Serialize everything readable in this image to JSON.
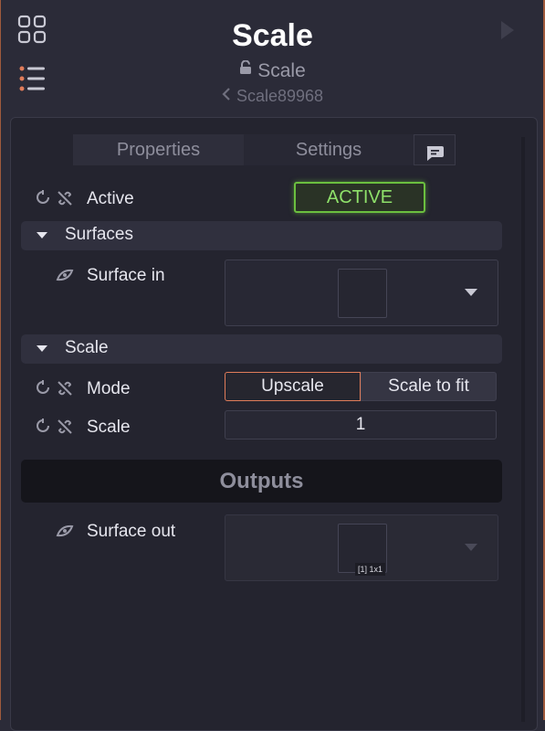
{
  "header": {
    "title": "Scale",
    "subtitle": "Scale",
    "breadcrumb": "Scale89968"
  },
  "tabs": {
    "properties": "Properties",
    "settings": "Settings"
  },
  "rows": {
    "active_label": "Active",
    "active_value": "ACTIVE",
    "surfaces_section": "Surfaces",
    "surface_in_label": "Surface in",
    "scale_section": "Scale",
    "mode_label": "Mode",
    "mode_option_1": "Upscale",
    "mode_option_2": "Scale to fit",
    "scale_label": "Scale",
    "scale_value": "1",
    "outputs_header": "Outputs",
    "surface_out_label": "Surface out",
    "surface_out_size": "[1] 1x1"
  },
  "colors": {
    "active_green": "#8ee06a",
    "mode_selected_border": "#e07c5a",
    "accent_orange": "#e07c5a"
  },
  "icons": {
    "grid": "grid-icon",
    "list": "list-icon",
    "play": "play-icon",
    "lock": "lock-icon",
    "back": "chevron-left-icon",
    "chat": "chat-icon",
    "reset": "reset-icon",
    "unlink": "unlink-icon",
    "eye": "eye-icon",
    "dropdown": "chevron-down-icon"
  }
}
